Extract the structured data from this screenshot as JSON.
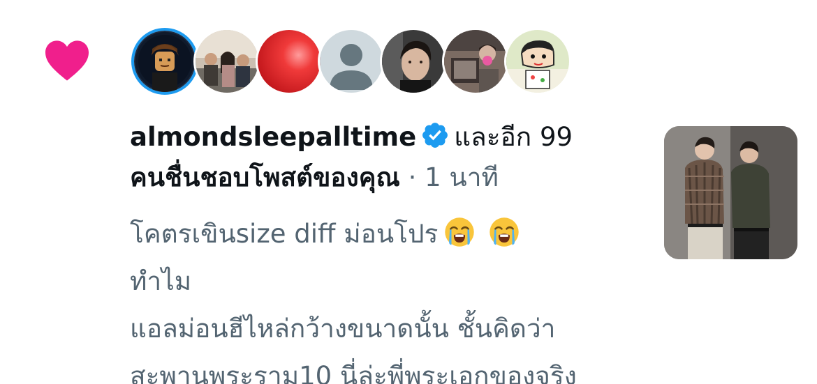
{
  "notification": {
    "icon": "heart-icon",
    "accent_color": "#f91880",
    "avatars": [
      {
        "name": "avatar-1",
        "icon": "lego-figure-avatar"
      },
      {
        "name": "avatar-2",
        "icon": "group-photo-avatar"
      },
      {
        "name": "avatar-3",
        "icon": "red-sphere-avatar"
      },
      {
        "name": "avatar-4",
        "icon": "default-profile-avatar"
      },
      {
        "name": "avatar-5",
        "icon": "portrait-avatar"
      },
      {
        "name": "avatar-6",
        "icon": "photo-avatar"
      },
      {
        "name": "avatar-7",
        "icon": "cartoon-avatar"
      }
    ],
    "username": "almondsleepalltime",
    "verified_color": "#1d9bf0",
    "and_others": "และอีก 99",
    "action_text": "คนชื่นชอบโพสต์ของคุณ",
    "separator": " · ",
    "time": "1 นาที"
  },
  "post": {
    "lines": [
      "โคตรเขินsize diff ม่อนโปร",
      "ทำไม",
      "แอลม่อนฮีไหล่กว้างขนาดนั้น ชั้นคิดว่า",
      "สะพานพระราม10 นี่ล่ะพี่พระเอกของจริง"
    ],
    "emojis": [
      "loudly-crying-face-icon",
      "loudly-crying-face-icon"
    ],
    "thumbnail": "post-photo-thumbnail"
  }
}
